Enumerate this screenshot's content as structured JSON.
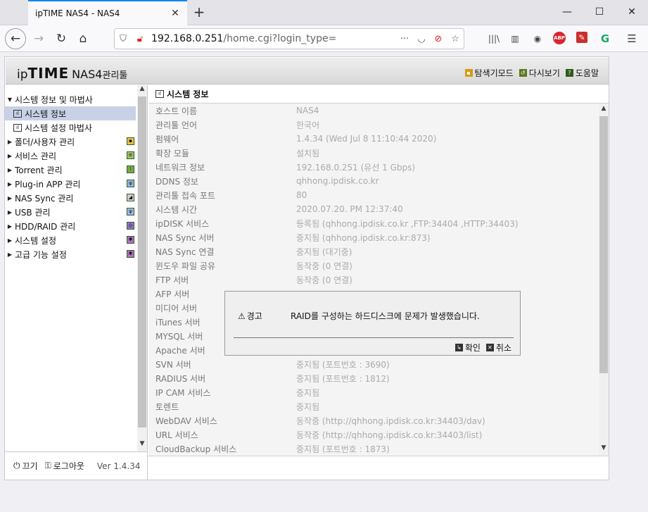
{
  "browser": {
    "tab_title": "ipTIME NAS4 - NAS4",
    "url_host": "192.168.0.251",
    "url_path": "/home.cgi?login_type="
  },
  "app": {
    "logo_ip": "ip",
    "logo_time": "TIME",
    "logo_model": "NAS4",
    "logo_mgr": "관리툴",
    "header_links": {
      "explore": "탐색기모드",
      "reload": "다시보기",
      "help": "도움말"
    }
  },
  "sidebar": {
    "items": [
      {
        "label": "시스템 정보 및 마법사"
      },
      {
        "label": "시스템 정보"
      },
      {
        "label": "시스템 설정 마법사"
      },
      {
        "label": "폴더/사용자 관리"
      },
      {
        "label": "서비스 관리"
      },
      {
        "label": "Torrent 관리"
      },
      {
        "label": "Plug-in APP 관리"
      },
      {
        "label": "NAS Sync 관리"
      },
      {
        "label": "USB 관리"
      },
      {
        "label": "HDD/RAID 관리"
      },
      {
        "label": "시스템 설정"
      },
      {
        "label": "고급 기능 설정"
      }
    ],
    "footer": {
      "power": "끄기",
      "logout": "로그아웃",
      "version": "Ver 1.4.34"
    }
  },
  "main": {
    "title": "시스템 정보",
    "rows": [
      {
        "k": "호스트 이름",
        "v": "NAS4"
      },
      {
        "k": "관리툴 언어",
        "v": "한국어"
      },
      {
        "k": "펌웨어",
        "v": "1.4.34 (Wed Jul 8 11:10:44 2020)"
      },
      {
        "k": "확장 모듈",
        "v": "설치됨"
      },
      {
        "k": "네트워크 정보",
        "v": "192.168.0.251 (유선 1 Gbps)"
      },
      {
        "k": "DDNS 정보",
        "v": "qhhong.ipdisk.co.kr"
      },
      {
        "k": "관리툴 접속 포트",
        "v": "80"
      },
      {
        "k": "시스템 시간",
        "v": "2020.07.20. PM 12:37:40"
      },
      {
        "k": "ipDISK 서비스",
        "v": "등록됨 (qhhong.ipdisk.co.kr ,FTP:34404 ,HTTP:34403)"
      },
      {
        "k": "NAS Sync 서버",
        "v": "중지됨 (qhhong.ipdisk.co.kr:873)"
      },
      {
        "k": "NAS Sync 연결",
        "v": "중지됨 (대기중)"
      },
      {
        "k": "윈도우 파일 공유",
        "v": "동작중 (0 연결)"
      },
      {
        "k": "FTP 서버",
        "v": "동작중 (0 연결)"
      },
      {
        "k": "AFP 서버",
        "v": ""
      },
      {
        "k": "미디어 서버",
        "v": ""
      },
      {
        "k": "iTunes 서버",
        "v": ""
      },
      {
        "k": "MYSQL 서버",
        "v": ""
      },
      {
        "k": "Apache 서버",
        "v": ""
      },
      {
        "k": "SVN 서버",
        "v": "중지됨 (포트번호 : 3690)"
      },
      {
        "k": "RADIUS 서버",
        "v": "중지됨 (포트번호 : 1812)"
      },
      {
        "k": "IP CAM 서비스",
        "v": "중지됨"
      },
      {
        "k": "토렌트",
        "v": "중지됨"
      },
      {
        "k": "WebDAV 서비스",
        "v": "동작중 (http://qhhong.ipdisk.co.kr:34403/dav)"
      },
      {
        "k": "URL 서비스",
        "v": "동작중 (http://qhhong.ipdisk.co.kr:34403/list)"
      },
      {
        "k": "CloudBackup 서비스",
        "v": "중지됨 (포트번호 : 1873)"
      }
    ]
  },
  "dialog": {
    "title": "경고",
    "message": "RAID를 구성하는 하드디스크에 문제가 발생했습니다.",
    "ok": "확인",
    "cancel": "취소"
  }
}
